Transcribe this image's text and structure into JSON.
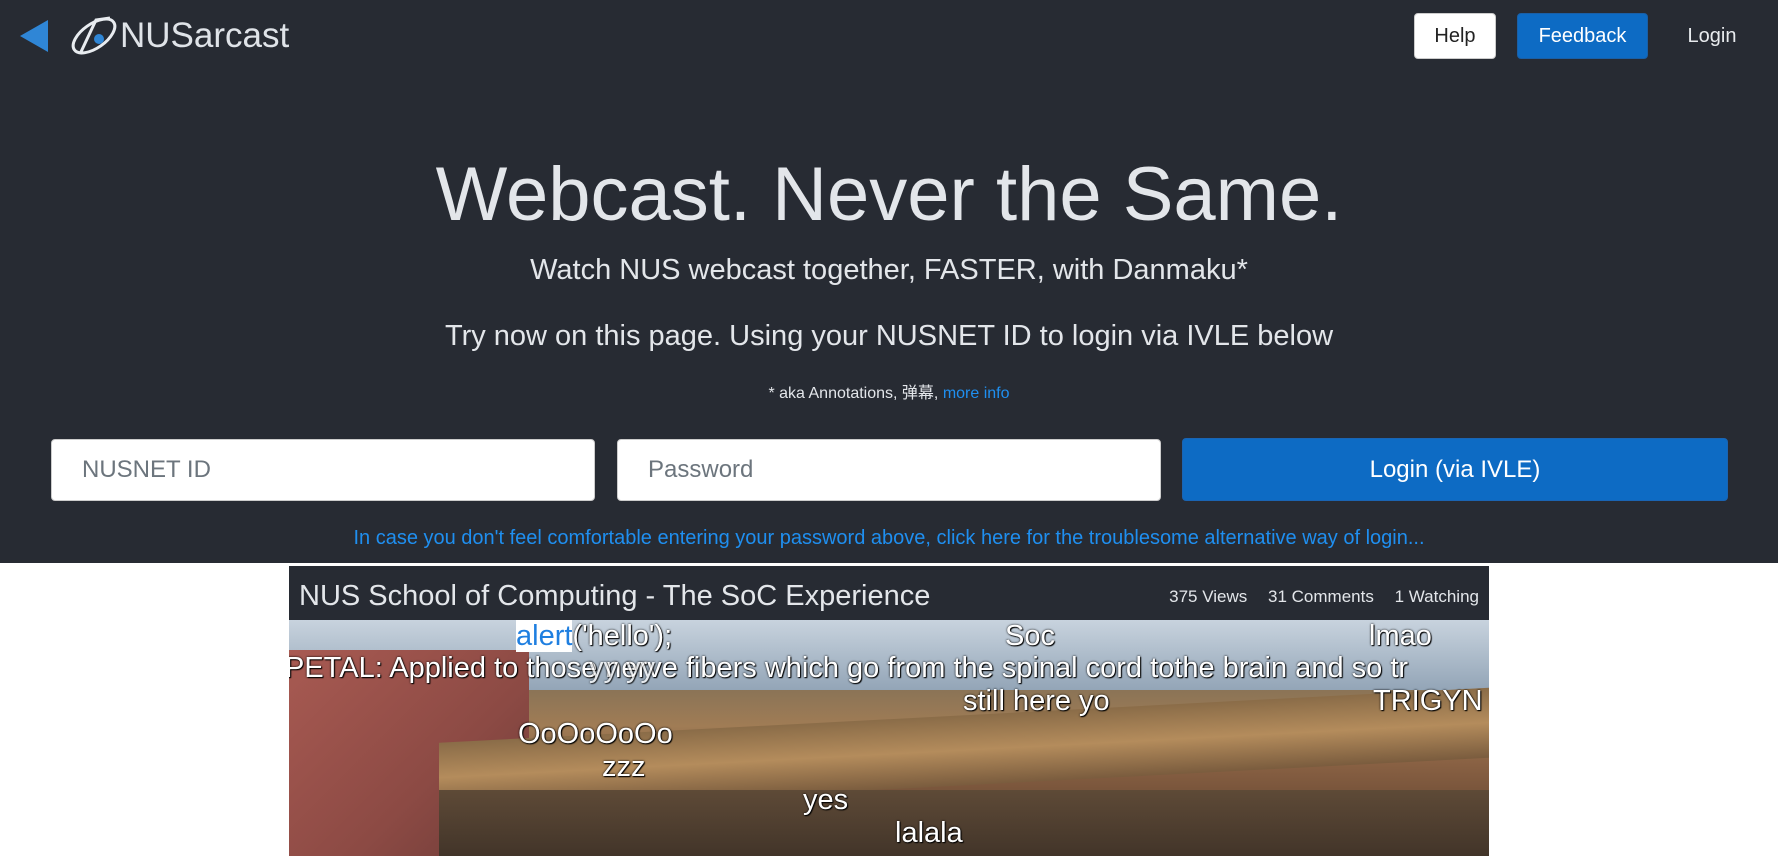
{
  "nav": {
    "brand": "NUSarcast",
    "help": "Help",
    "feedback": "Feedback",
    "login": "Login",
    "back_icon": "back-arrow-icon",
    "logo_icon": "satellite-logo-icon"
  },
  "hero": {
    "headline": "Webcast. Never the Same.",
    "subtitle": "Watch NUS webcast together, FASTER, with Danmaku*",
    "instruction": "Try now on this page. Using your NUSNET ID to login via IVLE below",
    "note_prefix": "* aka Annotations, 弹幕,",
    "note_link": "more info"
  },
  "login_form": {
    "id_placeholder": "NUSNET ID",
    "password_placeholder": "Password",
    "submit_label": "Login (via IVLE)",
    "alt_link": "In case you don't feel comfortable entering your password above, click here for the troublesome alternative way of login..."
  },
  "video": {
    "title": "NUS School of Computing - The SoC Experience",
    "views": "375 Views",
    "comments": "31 Comments",
    "watching": "1 Watching",
    "danmaku": {
      "alert_highlight": "alert",
      "alert_rest": "('hello');",
      "soc": "Soc",
      "lmao": "lmao",
      "petal": "PETAL: Applied to those nerve fibers which go from the spinal cord tothe brain and so tr",
      "overlap": "yy yy",
      "still_here": "still here yo",
      "trigyn": "TRIGYN",
      "oooo": "OoOoOoOo",
      "zzz": "zzz",
      "yes": "yes",
      "lalala": "lalala"
    }
  },
  "colors": {
    "background_dark": "#272b33",
    "primary_blue": "#0d6bc4",
    "link_blue": "#1f8ff0"
  }
}
